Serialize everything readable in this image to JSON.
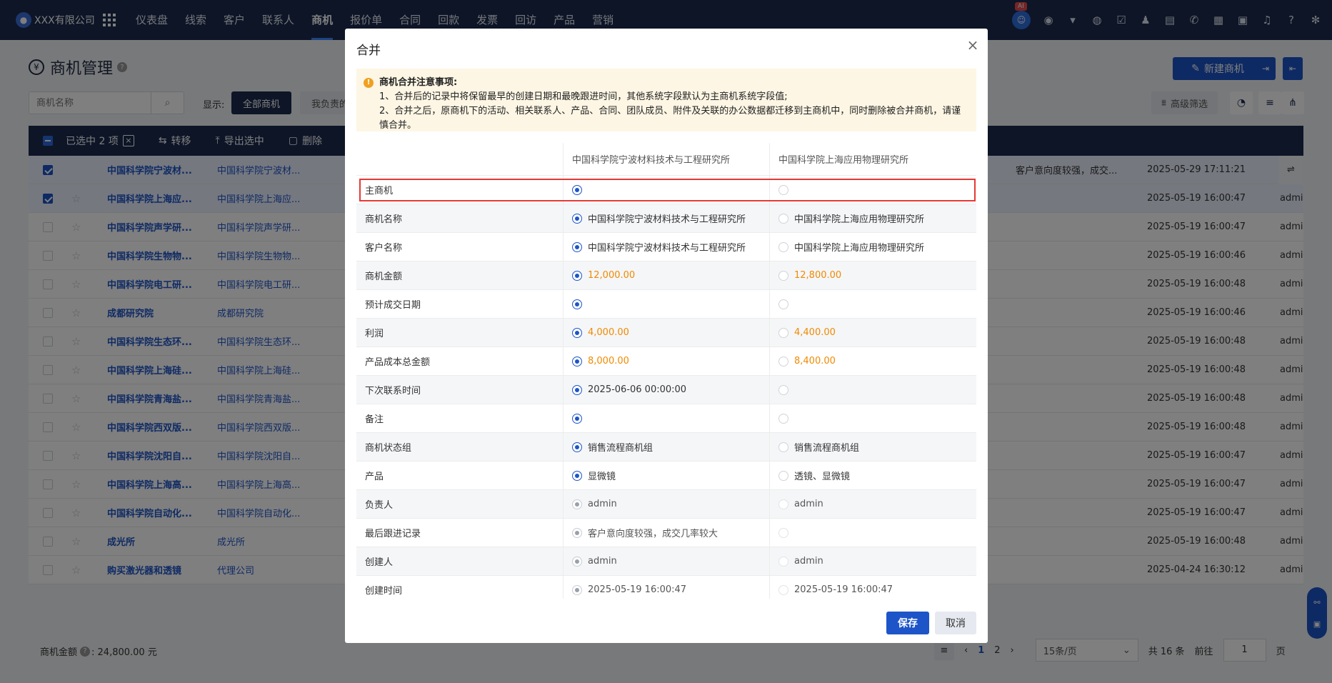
{
  "app": {
    "logo_text": "XXX有限公司",
    "ai_tag": "AI",
    "nav": [
      "仪表盘",
      "线索",
      "客户",
      "联系人",
      "商机",
      "报价单",
      "合同",
      "回款",
      "发票",
      "回访",
      "产品",
      "营销"
    ],
    "active_nav": "商机"
  },
  "page": {
    "title": "商机管理",
    "new_button": "新建商机",
    "search_placeholder": "商机名称",
    "show_label": "显示:",
    "filter_active": "全部商机",
    "filter_other": "我负责的",
    "advanced_filter": "高级筛选",
    "toolbar": {
      "selected": "已选中 2 项",
      "transfer": "转移",
      "export": "导出选中",
      "delete": "删除"
    },
    "rows": [
      {
        "checked": true,
        "name": "中国科学院宁波材...",
        "customer": "中国科学院宁波材...",
        "note": "客户意向度较强，成交...",
        "time": "2025-05-29 17:11:21",
        "owner": ""
      },
      {
        "checked": true,
        "name": "中国科学院上海应...",
        "customer": "中国科学院上海应...",
        "note": "",
        "time": "2025-05-19 16:00:47",
        "owner": "admi"
      },
      {
        "checked": false,
        "name": "中国科学院声学研...",
        "customer": "中国科学院声学研...",
        "note": "",
        "time": "2025-05-19 16:00:47",
        "owner": "admi"
      },
      {
        "checked": false,
        "name": "中国科学院生物物...",
        "customer": "中国科学院生物物...",
        "note": "",
        "time": "2025-05-19 16:00:46",
        "owner": "admi"
      },
      {
        "checked": false,
        "name": "中国科学院电工研...",
        "customer": "中国科学院电工研...",
        "note": "",
        "time": "2025-05-19 16:00:48",
        "owner": "admi"
      },
      {
        "checked": false,
        "name": "成都研究院",
        "customer": "成都研究院",
        "note": "",
        "time": "2025-05-19 16:00:46",
        "owner": "admi"
      },
      {
        "checked": false,
        "name": "中国科学院生态环...",
        "customer": "中国科学院生态环...",
        "note": "",
        "time": "2025-05-19 16:00:48",
        "owner": "admi"
      },
      {
        "checked": false,
        "name": "中国科学院上海硅...",
        "customer": "中国科学院上海硅...",
        "note": "",
        "time": "2025-05-19 16:00:48",
        "owner": "admi"
      },
      {
        "checked": false,
        "name": "中国科学院青海盐...",
        "customer": "中国科学院青海盐...",
        "note": "",
        "time": "2025-05-19 16:00:48",
        "owner": "admi"
      },
      {
        "checked": false,
        "name": "中国科学院西双版...",
        "customer": "中国科学院西双版...",
        "note": "",
        "time": "2025-05-19 16:00:48",
        "owner": "admi"
      },
      {
        "checked": false,
        "name": "中国科学院沈阳自...",
        "customer": "中国科学院沈阳自...",
        "note": "",
        "time": "2025-05-19 16:00:47",
        "owner": "admi"
      },
      {
        "checked": false,
        "name": "中国科学院上海高...",
        "customer": "中国科学院上海高...",
        "note": "",
        "time": "2025-05-19 16:00:47",
        "owner": "admi"
      },
      {
        "checked": false,
        "name": "中国科学院自动化...",
        "customer": "中国科学院自动化...",
        "note": "",
        "time": "2025-05-19 16:00:47",
        "owner": "admi"
      },
      {
        "checked": false,
        "name": "成光所",
        "customer": "成光所",
        "note": "",
        "time": "2025-05-19 16:00:48",
        "owner": "admi"
      },
      {
        "checked": false,
        "name": "购买激光器和透镜",
        "customer": "代理公司",
        "note": "",
        "time": "2025-04-24 16:30:12",
        "owner": "admi"
      }
    ],
    "footer": {
      "sum_label": "商机金额",
      "sum_value": ": 24,800.00 元",
      "pages": [
        "1",
        "2"
      ],
      "page_size": "15条/页",
      "total": "共 16 条",
      "goto_label": "前往",
      "goto_value": "1",
      "page_unit": "页"
    }
  },
  "modal": {
    "title": "合并",
    "notice_title": "商机合并注意事项:",
    "notice_1": "1、合并后的记录中将保留最早的创建日期和最晚跟进时间，其他系统字段默认为主商机系统字段值;",
    "notice_2": "2、合并之后，原商机下的活动、相关联系人、产品、合同、团队成员、附件及关联的办公数据都迁移到主商机中，同时删除被合并商机，请谨慎合并。",
    "col_a": "中国科学院宁波材料技术与工程研究所",
    "col_b": "中国科学院上海应用物理研究所",
    "fields": [
      {
        "label": "主商机",
        "a": "",
        "b": "",
        "money": false,
        "dim": false
      },
      {
        "label": "商机名称",
        "a": "中国科学院宁波材料技术与工程研究所",
        "b": "中国科学院上海应用物理研究所",
        "money": false,
        "dim": false
      },
      {
        "label": "客户名称",
        "a": "中国科学院宁波材料技术与工程研究所",
        "b": "中国科学院上海应用物理研究所",
        "money": false,
        "dim": false
      },
      {
        "label": "商机金额",
        "a": "12,000.00",
        "b": "12,800.00",
        "money": true,
        "dim": false
      },
      {
        "label": "预计成交日期",
        "a": "",
        "b": "",
        "money": false,
        "dim": false
      },
      {
        "label": "利润",
        "a": "4,000.00",
        "b": "4,400.00",
        "money": true,
        "dim": false
      },
      {
        "label": "产品成本总金额",
        "a": "8,000.00",
        "b": "8,400.00",
        "money": true,
        "dim": false
      },
      {
        "label": "下次联系时间",
        "a": "2025-06-06 00:00:00",
        "b": "",
        "money": false,
        "dim": false
      },
      {
        "label": "备注",
        "a": "",
        "b": "",
        "money": false,
        "dim": false
      },
      {
        "label": "商机状态组",
        "a": "销售流程商机组",
        "b": "销售流程商机组",
        "money": false,
        "dim": false
      },
      {
        "label": "产品",
        "a": "显微镜",
        "b": "透镜、显微镜",
        "money": false,
        "dim": false
      },
      {
        "label": "负责人",
        "a": "admin",
        "b": "admin",
        "money": false,
        "dim": true
      },
      {
        "label": "最后跟进记录",
        "a": "客户意向度较强，成交几率较大",
        "b": "",
        "money": false,
        "dim": true
      },
      {
        "label": "创建人",
        "a": "admin",
        "b": "admin",
        "money": false,
        "dim": true
      },
      {
        "label": "创建时间",
        "a": "2025-05-19 16:00:47",
        "b": "2025-05-19 16:00:47",
        "money": false,
        "dim": true
      }
    ],
    "save": "保存",
    "cancel": "取消"
  }
}
